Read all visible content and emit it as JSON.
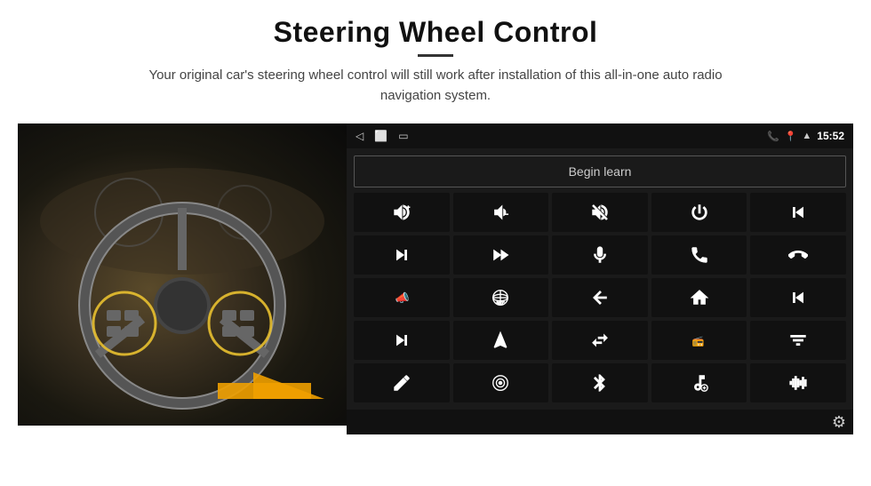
{
  "header": {
    "title": "Steering Wheel Control",
    "subtitle": "Your original car's steering wheel control will still work after installation of this all-in-one auto radio navigation system."
  },
  "statusbar": {
    "time": "15:52",
    "nav_back": "◁",
    "nav_home": "⬜",
    "nav_recent": "▭"
  },
  "controls": {
    "begin_learn_label": "Begin learn",
    "icons": [
      {
        "id": "vol-up",
        "symbol": "🔊+"
      },
      {
        "id": "vol-down",
        "symbol": "🔉−"
      },
      {
        "id": "vol-mute",
        "symbol": "🔇"
      },
      {
        "id": "power",
        "symbol": "⏻"
      },
      {
        "id": "prev-track",
        "symbol": "⏮"
      },
      {
        "id": "next-track",
        "symbol": "⏭"
      },
      {
        "id": "fast-forward",
        "symbol": "⏩"
      },
      {
        "id": "mic",
        "symbol": "🎤"
      },
      {
        "id": "phone",
        "symbol": "📞"
      },
      {
        "id": "hang-up",
        "symbol": "📵"
      },
      {
        "id": "horn",
        "symbol": "📣"
      },
      {
        "id": "360-view",
        "symbol": "👁"
      },
      {
        "id": "back",
        "symbol": "↩"
      },
      {
        "id": "home",
        "symbol": "⌂"
      },
      {
        "id": "skip-back",
        "symbol": "⏮"
      },
      {
        "id": "skip-fwd",
        "symbol": "⏭"
      },
      {
        "id": "navigate",
        "symbol": "➤"
      },
      {
        "id": "exchange",
        "symbol": "⇄"
      },
      {
        "id": "radio",
        "symbol": "📻"
      },
      {
        "id": "equalizer",
        "symbol": "🎛"
      },
      {
        "id": "pen",
        "symbol": "✏"
      },
      {
        "id": "target",
        "symbol": "🎯"
      },
      {
        "id": "bluetooth",
        "symbol": "⚡"
      },
      {
        "id": "music-settings",
        "symbol": "🎵"
      },
      {
        "id": "waveform",
        "symbol": "📊"
      }
    ]
  }
}
